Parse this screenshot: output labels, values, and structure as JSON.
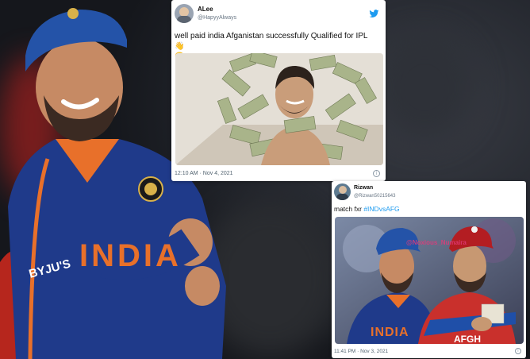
{
  "tweet1": {
    "name": "ALee",
    "handle": "@HapyyAlways",
    "text": "well paid india Afganistan successfully Qualified for IPL",
    "emoji1": "👋",
    "emoji2": "🤫",
    "time": "12:10 AM · Nov 4, 2021",
    "platform_icon": "twitter-bird-icon",
    "accent": "#1d9bf0"
  },
  "tweet2": {
    "name": "Rizwan",
    "handle": "@Rizwan50215643",
    "text_prefix": "match fxr",
    "hashtag": "#INDvsAFG",
    "time": "11:41 PM · Nov 3, 2021",
    "watermark": "@Noxious_Numaira"
  },
  "jersey": {
    "team_text": "INDIA",
    "sponsor_text": "BYJU'S"
  },
  "photo_jersey": {
    "left_text": "INDIA",
    "right_text": "AFGH"
  }
}
